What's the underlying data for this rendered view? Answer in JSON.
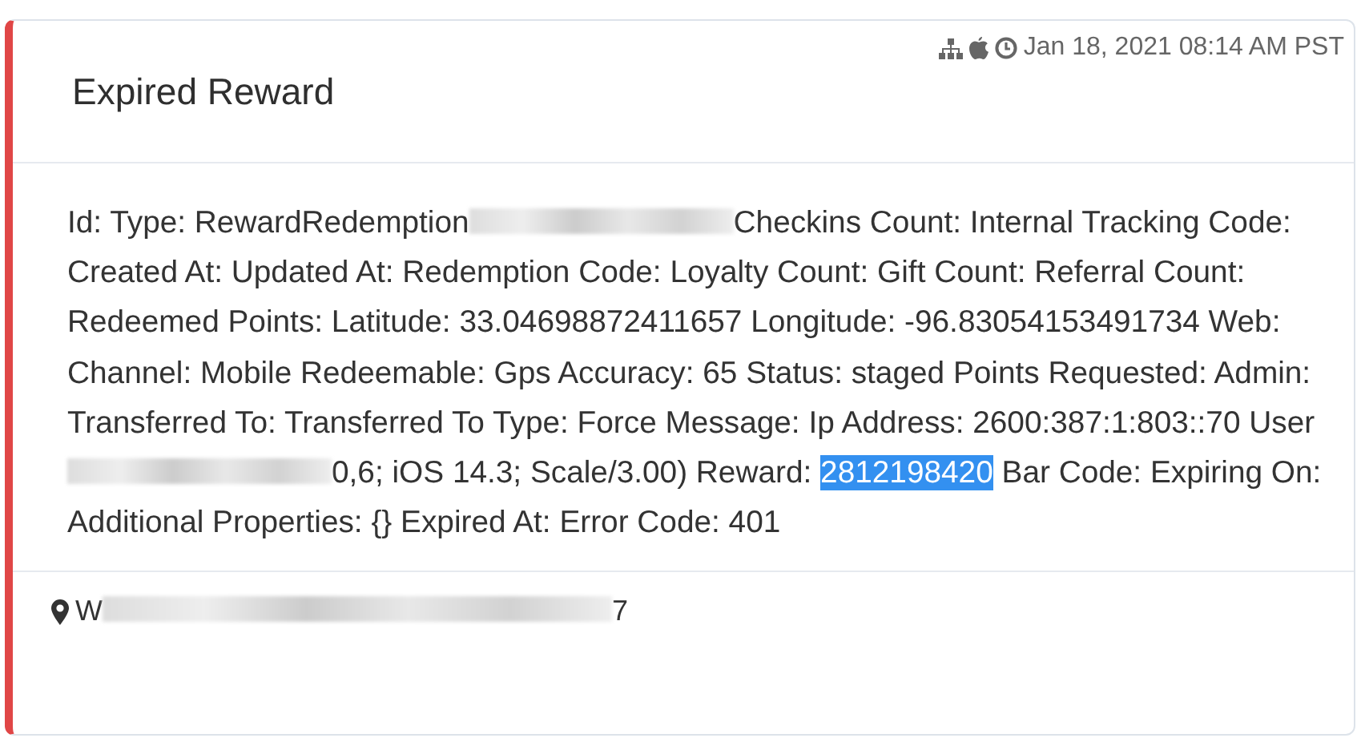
{
  "card": {
    "title": "Expired Reward",
    "timestamp": "Jan 18, 2021 08:14 AM PST",
    "details": [
      {
        "kind": "text",
        "text": "Id: Type: RewardRedemption"
      },
      {
        "kind": "redacted"
      },
      {
        "kind": "text",
        "text": "Checkins Count: Internal Tracking Code: Created At: Updated At: Redemption Code: Loyalty Count: Gift Count: Referral Count: Redeemed Points: Latitude: 33.04698872411657 Longitude: -96.83054153491734 Web: Channel: Mobile Redeemable: Gps Accuracy: 65 Status: staged Points Requested: Admin: Transferred To: Transferred To Type: Force Message: Ip Address: 2600:387:1:803::70 User"
      },
      {
        "kind": "redacted"
      },
      {
        "kind": "text",
        "text": "0,6; iOS 14.3; Scale/3.00) Reward: "
      },
      {
        "kind": "selected",
        "text": "2812198420"
      },
      {
        "kind": "text",
        "text": " Bar Code: Expiring On: Additional Properties: {} Expired At: Error Code: 401"
      }
    ],
    "location": [
      {
        "kind": "text",
        "text": "W"
      },
      {
        "kind": "redacted"
      },
      {
        "kind": "text",
        "text": "7"
      }
    ]
  }
}
